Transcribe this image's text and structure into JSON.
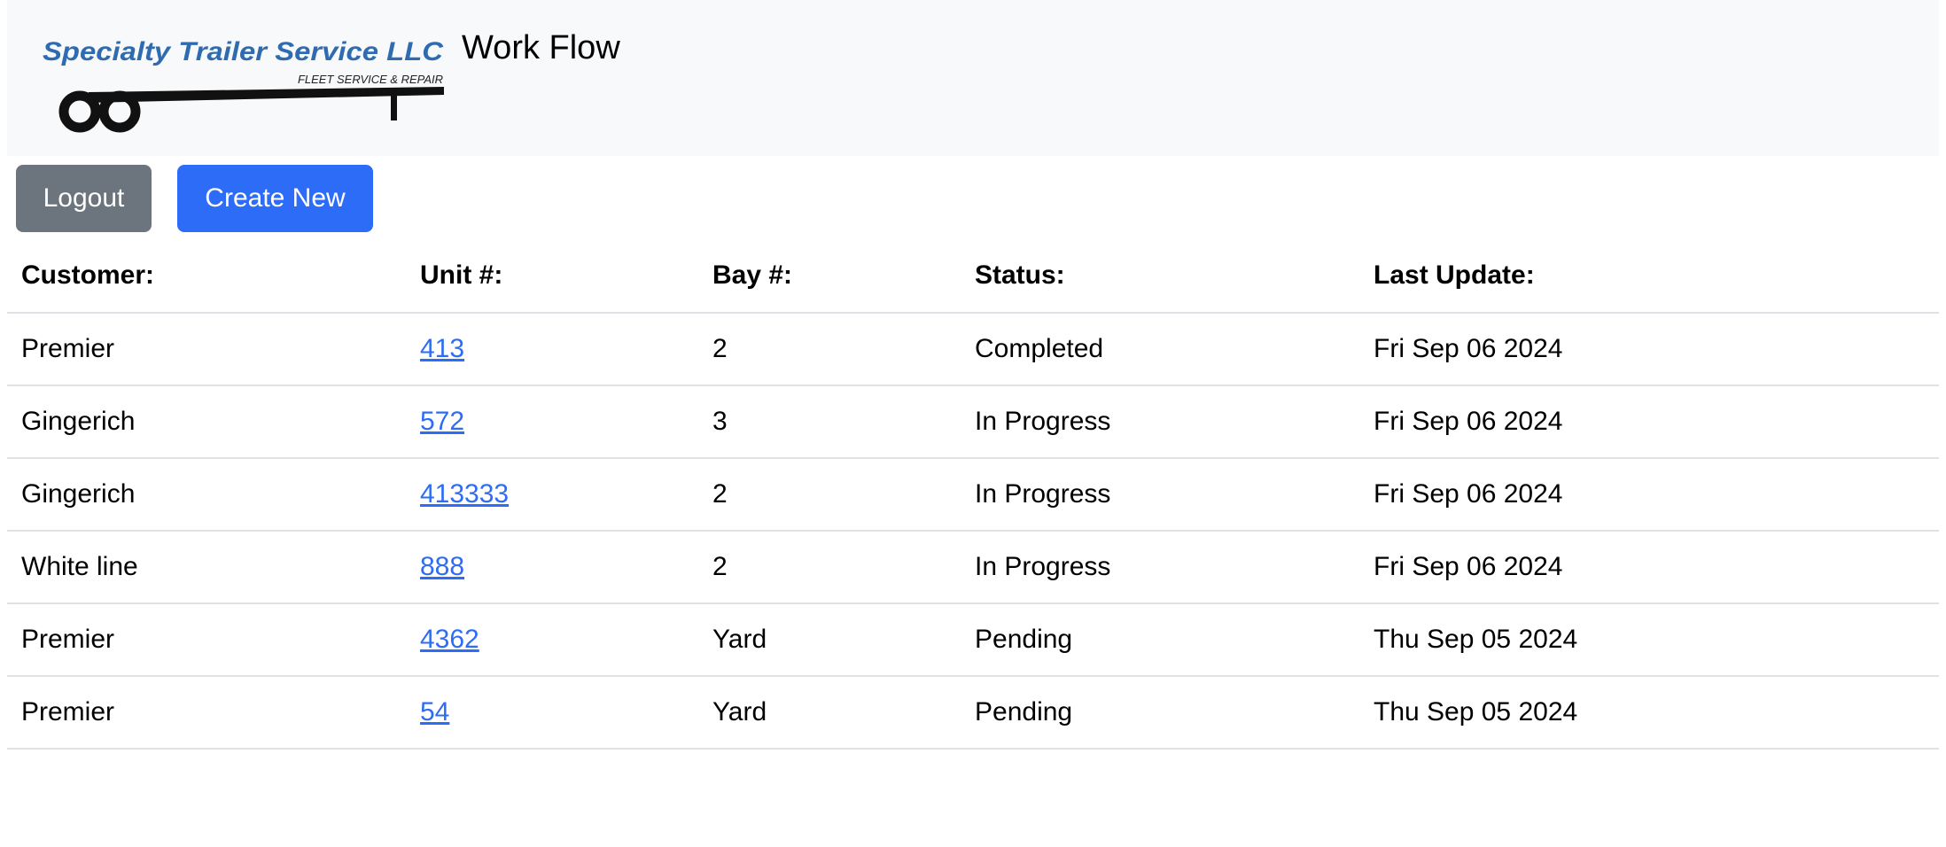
{
  "brand": {
    "logo_line1": "Specialty Trailer Service LLC",
    "logo_line2": "FLEET SERVICE & REPAIR",
    "app_title": "Work Flow",
    "logo_color": "#2f6bb0"
  },
  "toolbar": {
    "logout_label": "Logout",
    "create_label": "Create New"
  },
  "table": {
    "headers": {
      "customer": "Customer:",
      "unit": "Unit #:",
      "bay": "Bay #:",
      "status": "Status:",
      "last_update": "Last Update:"
    },
    "rows": [
      {
        "customer": "Premier",
        "unit": "413",
        "bay": "2",
        "status": "Completed",
        "last_update": "Fri Sep 06 2024"
      },
      {
        "customer": "Gingerich",
        "unit": "572",
        "bay": "3",
        "status": "In Progress",
        "last_update": "Fri Sep 06 2024"
      },
      {
        "customer": "Gingerich",
        "unit": "413333",
        "bay": "2",
        "status": "In Progress",
        "last_update": "Fri Sep 06 2024"
      },
      {
        "customer": "White line",
        "unit": "888",
        "bay": "2",
        "status": "In Progress",
        "last_update": "Fri Sep 06 2024"
      },
      {
        "customer": "Premier",
        "unit": "4362",
        "bay": "Yard",
        "status": "Pending",
        "last_update": "Thu Sep 05 2024"
      },
      {
        "customer": "Premier",
        "unit": "54",
        "bay": "Yard",
        "status": "Pending",
        "last_update": "Thu Sep 05 2024"
      }
    ]
  },
  "colors": {
    "navbar_bg": "#f8f9fa",
    "logout_bg": "#6c757d",
    "create_bg": "#2d6cf6",
    "link": "#2d6cf6"
  }
}
